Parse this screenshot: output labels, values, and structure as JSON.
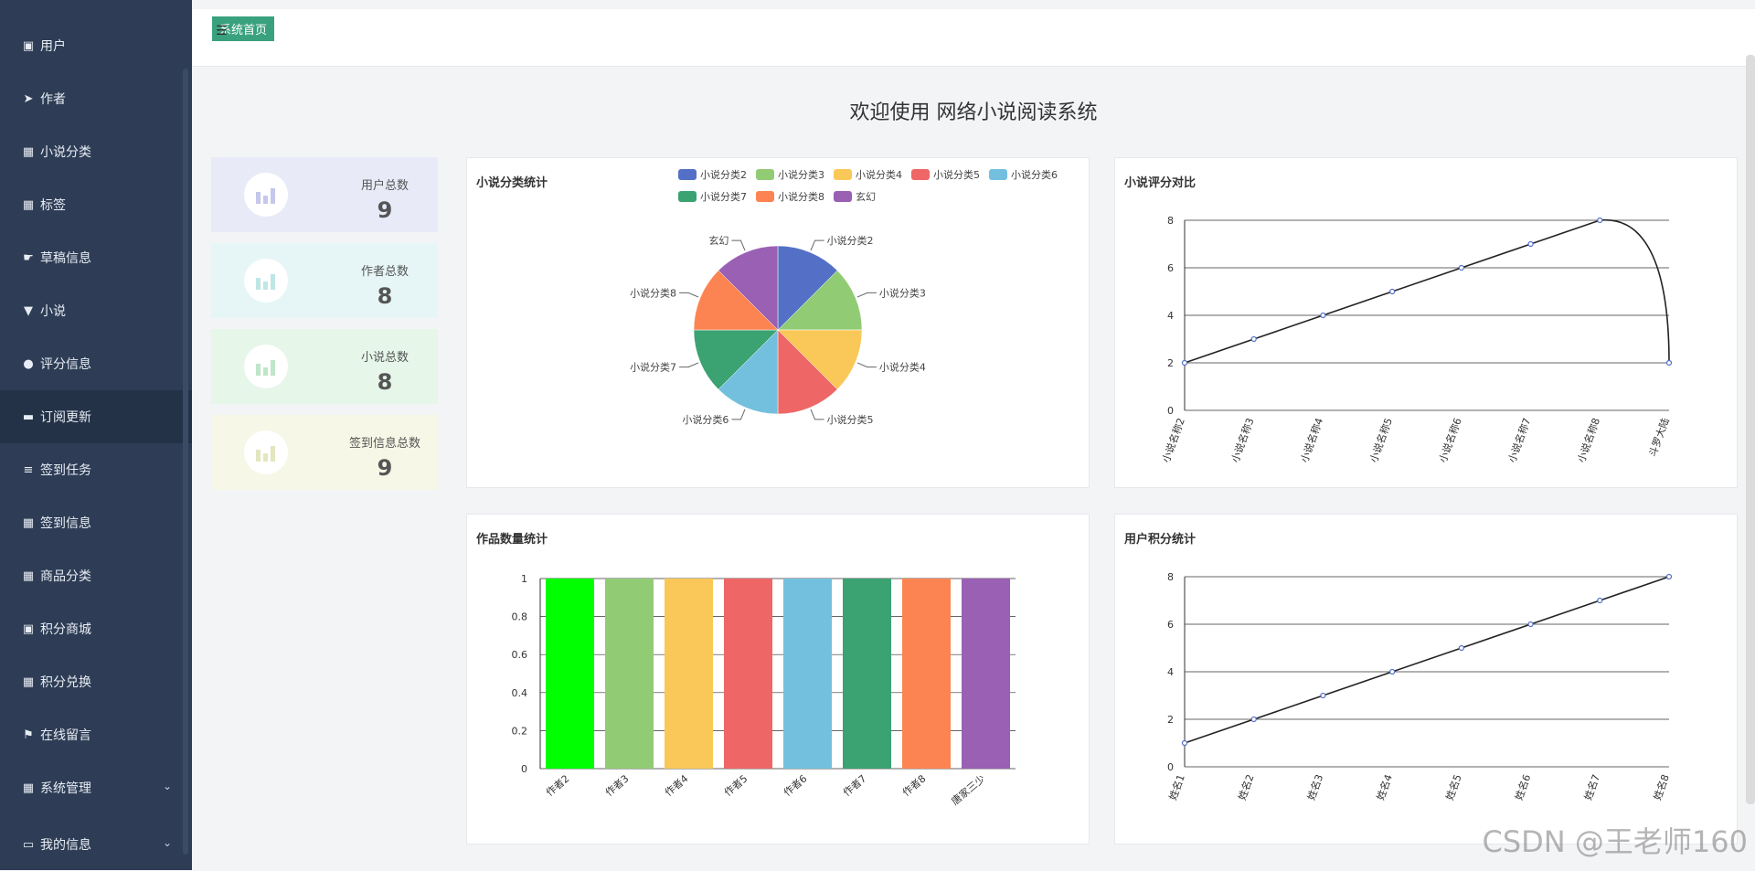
{
  "sidebar": {
    "items": [
      {
        "label": "用户",
        "icon": "clipboard-icon"
      },
      {
        "label": "作者",
        "icon": "paper-plane-icon"
      },
      {
        "label": "小说分类",
        "icon": "grid-icon"
      },
      {
        "label": "标签",
        "icon": "grid-icon"
      },
      {
        "label": "草稿信息",
        "icon": "hand-icon"
      },
      {
        "label": "小说",
        "icon": "pin-icon"
      },
      {
        "label": "评分信息",
        "icon": "user-icon"
      },
      {
        "label": "订阅更新",
        "icon": "ticket-icon"
      },
      {
        "label": "签到任务",
        "icon": "list-icon"
      },
      {
        "label": "签到信息",
        "icon": "grid-icon"
      },
      {
        "label": "商品分类",
        "icon": "grid-icon"
      },
      {
        "label": "积分商城",
        "icon": "clipboard-icon"
      },
      {
        "label": "积分兑换",
        "icon": "grid-icon"
      },
      {
        "label": "在线留言",
        "icon": "flag-icon"
      },
      {
        "label": "系统管理",
        "icon": "grid-icon"
      },
      {
        "label": "我的信息",
        "icon": "window-icon"
      }
    ]
  },
  "topbar": {
    "home_label": "系统首页"
  },
  "welcome": "欢迎使用 网络小说阅读系统",
  "stats": [
    {
      "label": "用户总数",
      "value": "9",
      "color": "#e8eaf8",
      "icon_color": "#c5c8ec"
    },
    {
      "label": "作者总数",
      "value": "8",
      "color": "#e6f6f6",
      "icon_color": "#bfe6e6"
    },
    {
      "label": "小说总数",
      "value": "8",
      "color": "#e6f6e9",
      "icon_color": "#bfe6c8"
    },
    {
      "label": "签到信息总数",
      "value": "9",
      "color": "#f6f7e6",
      "icon_color": "#e3e6bf"
    }
  ],
  "panels": {
    "pie_title": "小说分类统计",
    "line1_title": "小说评分对比",
    "bar_title": "作品数量统计",
    "line2_title": "用户积分统计"
  },
  "chart_data": [
    {
      "type": "pie",
      "title": "小说分类统计",
      "categories": [
        "小说分类2",
        "小说分类3",
        "小说分类4",
        "小说分类5",
        "小说分类6",
        "小说分类7",
        "小说分类8",
        "玄幻"
      ],
      "values": [
        1,
        1,
        1,
        1,
        1,
        1,
        1,
        1
      ],
      "colors": [
        "#5470c6",
        "#91cc75",
        "#fac858",
        "#ee6666",
        "#73c0de",
        "#3ba272",
        "#fc8452",
        "#9a60b4"
      ],
      "legend": "top-right"
    },
    {
      "type": "line",
      "title": "小说评分对比",
      "x": [
        "小说名称2",
        "小说名称3",
        "小说名称4",
        "小说名称5",
        "小说名称6",
        "小说名称7",
        "小说名称8",
        "斗罗大陆"
      ],
      "values": [
        2,
        3,
        4,
        5,
        6,
        7,
        8,
        2
      ],
      "ylim": [
        0,
        8
      ],
      "yticks": [
        0,
        2,
        4,
        6,
        8
      ],
      "grid": true
    },
    {
      "type": "bar",
      "title": "作品数量统计",
      "categories": [
        "作者2",
        "作者3",
        "作者4",
        "作者5",
        "作者6",
        "作者7",
        "作者8",
        "唐家三少"
      ],
      "values": [
        1,
        1,
        1,
        1,
        1,
        1,
        1,
        1
      ],
      "colors": [
        "#00ff00",
        "#91cc75",
        "#fac858",
        "#ee6666",
        "#73c0de",
        "#3ba272",
        "#fc8452",
        "#9a60b4"
      ],
      "ylim": [
        0,
        1
      ],
      "yticks": [
        "0",
        "0.2",
        "0.4",
        "0.6",
        "0.8",
        "1"
      ],
      "grid": true
    },
    {
      "type": "line",
      "title": "用户积分统计",
      "x": [
        "姓名1",
        "姓名2",
        "姓名3",
        "姓名4",
        "姓名5",
        "姓名6",
        "姓名7",
        "姓名8"
      ],
      "values": [
        1,
        2,
        3,
        4,
        5,
        6,
        7,
        8
      ],
      "ylim": [
        0,
        8
      ],
      "yticks": [
        0,
        2,
        4,
        6,
        8
      ],
      "grid": true
    }
  ],
  "watermark": "CSDN @王老师160"
}
